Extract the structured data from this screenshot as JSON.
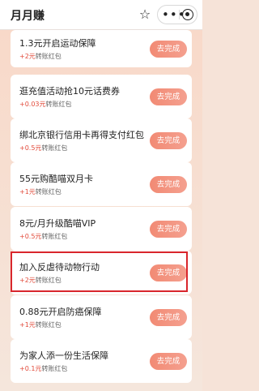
{
  "header": {
    "title": "月月赚",
    "star_icon": "star-outline-icon",
    "more_icon": "more-dots-icon",
    "close_icon": "capsule-close-icon"
  },
  "tasks": [
    {
      "title": "1.3元开启运动保障",
      "reward_amount": "+2元",
      "reward_suffix": "转账红包",
      "button": "去完成"
    },
    {
      "title": "逛充值活动抢10元话费券",
      "reward_amount": "+0.03元",
      "reward_suffix": "转账红包",
      "button": "去完成"
    },
    {
      "title": "绑北京银行信用卡再得支付红包",
      "reward_amount": "+0.5元",
      "reward_suffix": "转账红包",
      "button": "去完成"
    },
    {
      "title": "55元购酷喵双月卡",
      "reward_amount": "+1元",
      "reward_suffix": "转账红包",
      "button": "去完成"
    },
    {
      "title": "8元/月升级酷喵VIP",
      "reward_amount": "+0.5元",
      "reward_suffix": "转账红包",
      "button": "去完成"
    },
    {
      "title": "加入反虐待动物行动",
      "reward_amount": "+2元",
      "reward_suffix": "转账红包",
      "button": "去完成"
    },
    {
      "title": "0.88元开启防癌保障",
      "reward_amount": "+1元",
      "reward_suffix": "转账红包",
      "button": "去完成"
    },
    {
      "title": "为家人添一份生活保障",
      "reward_amount": "+0.1元",
      "reward_suffix": "转账红包",
      "button": "去完成"
    }
  ],
  "colors": {
    "accent": "#e24b3b",
    "button": "#f28a74",
    "highlight_border": "#d9262c"
  }
}
